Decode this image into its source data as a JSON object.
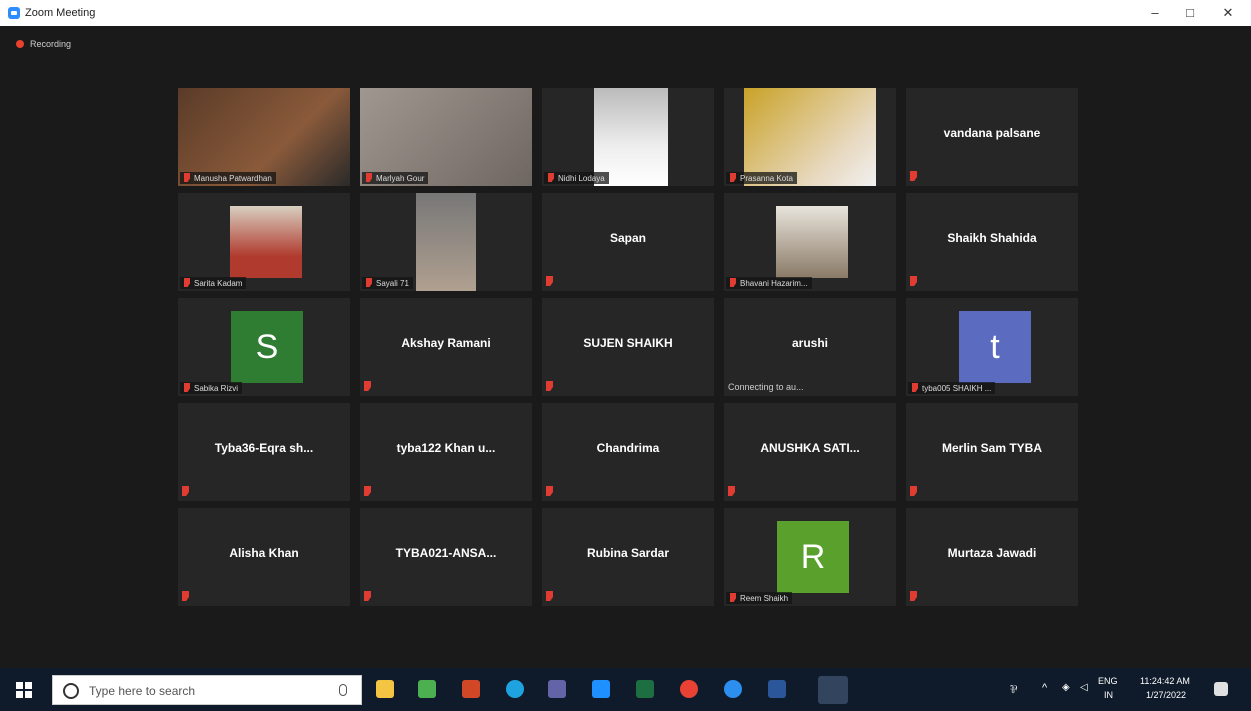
{
  "window": {
    "title": "Zoom Meeting",
    "minimize": "–",
    "maximize": "□",
    "close": "✕"
  },
  "recording": {
    "label": "Recording"
  },
  "tiles": [
    {
      "name": "Manusha Patwardhan",
      "kind": "video",
      "label": "Manusha Patwardhan"
    },
    {
      "name": "Marlyah Gour",
      "kind": "video",
      "label": "Marlyah Gour"
    },
    {
      "name": "Nidhi Lodaya",
      "kind": "video",
      "label": "Nidhi Lodaya"
    },
    {
      "name": "Prasanna Kota",
      "kind": "video",
      "label": "Prasanna Kota"
    },
    {
      "name": "vandana palsane",
      "kind": "name"
    },
    {
      "name": "Sarita Kadam",
      "kind": "photo",
      "label": "Sarita Kadam"
    },
    {
      "name": "Sayali 71",
      "kind": "video",
      "label": "Sayali 71"
    },
    {
      "name": "Sapan",
      "kind": "name"
    },
    {
      "name": "Bhavani Hazarim...",
      "kind": "photo",
      "label": "Bhavani Hazarim..."
    },
    {
      "name": "Shaikh Shahida",
      "kind": "name"
    },
    {
      "name": "Sabika Rizvi",
      "kind": "avatar",
      "letter": "S",
      "color": "#2e7d32",
      "label": "Sabika Rizvi"
    },
    {
      "name": "Akshay Ramani",
      "kind": "name"
    },
    {
      "name": "SUJEN SHAIKH",
      "kind": "name"
    },
    {
      "name": "arushi",
      "kind": "name",
      "status": "Connecting to au..."
    },
    {
      "name": "tyba005 SHAIKH ...",
      "kind": "avatar",
      "letter": "t",
      "color": "#5b6bc0",
      "label": "tyba005 SHAIKH ..."
    },
    {
      "name": "Tyba36-Eqra sh...",
      "kind": "name"
    },
    {
      "name": "tyba122 Khan u...",
      "kind": "name"
    },
    {
      "name": "Chandrima",
      "kind": "name"
    },
    {
      "name": "ANUSHKA SATI...",
      "kind": "name"
    },
    {
      "name": "Merlin Sam TYBA",
      "kind": "name"
    },
    {
      "name": "Alisha Khan",
      "kind": "name"
    },
    {
      "name": "TYBA021-ANSA...",
      "kind": "name"
    },
    {
      "name": "Rubina Sardar",
      "kind": "name"
    },
    {
      "name": "Reem Shaikh",
      "kind": "avatar",
      "letter": "R",
      "color": "#5aa02c",
      "label": "Reem Shaikh"
    },
    {
      "name": "Murtaza Jawadi",
      "kind": "name"
    }
  ],
  "taskbar": {
    "search_placeholder": "Type here to search",
    "tray": {
      "lang": "ENG",
      "region": "IN",
      "time": "11:24:42 AM",
      "date": "1/27/2022"
    }
  },
  "colors": {
    "active_speaker": "#c8e04a",
    "tile_bg": "#262626",
    "mic_muted": "#e03c31"
  }
}
